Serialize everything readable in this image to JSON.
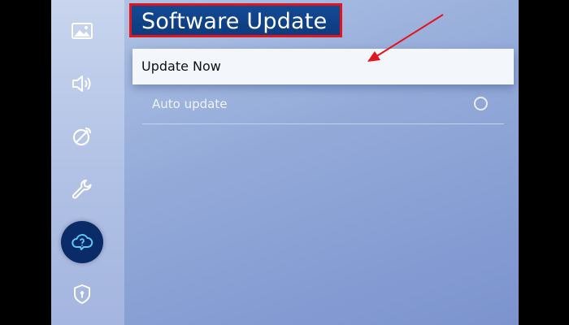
{
  "sidebar": {
    "items": [
      {
        "name": "picture-icon"
      },
      {
        "name": "sound-icon"
      },
      {
        "name": "broadcasting-icon"
      },
      {
        "name": "general-icon"
      },
      {
        "name": "support-icon",
        "active": true
      },
      {
        "name": "privacy-icon"
      }
    ]
  },
  "header": {
    "title": "Software Update"
  },
  "menu": {
    "update_now_label": "Update Now",
    "auto_update_label": "Auto update",
    "auto_update_enabled": false
  },
  "annotation": {
    "arrow_color": "#e3141c",
    "highlight_color": "#e3141c"
  }
}
